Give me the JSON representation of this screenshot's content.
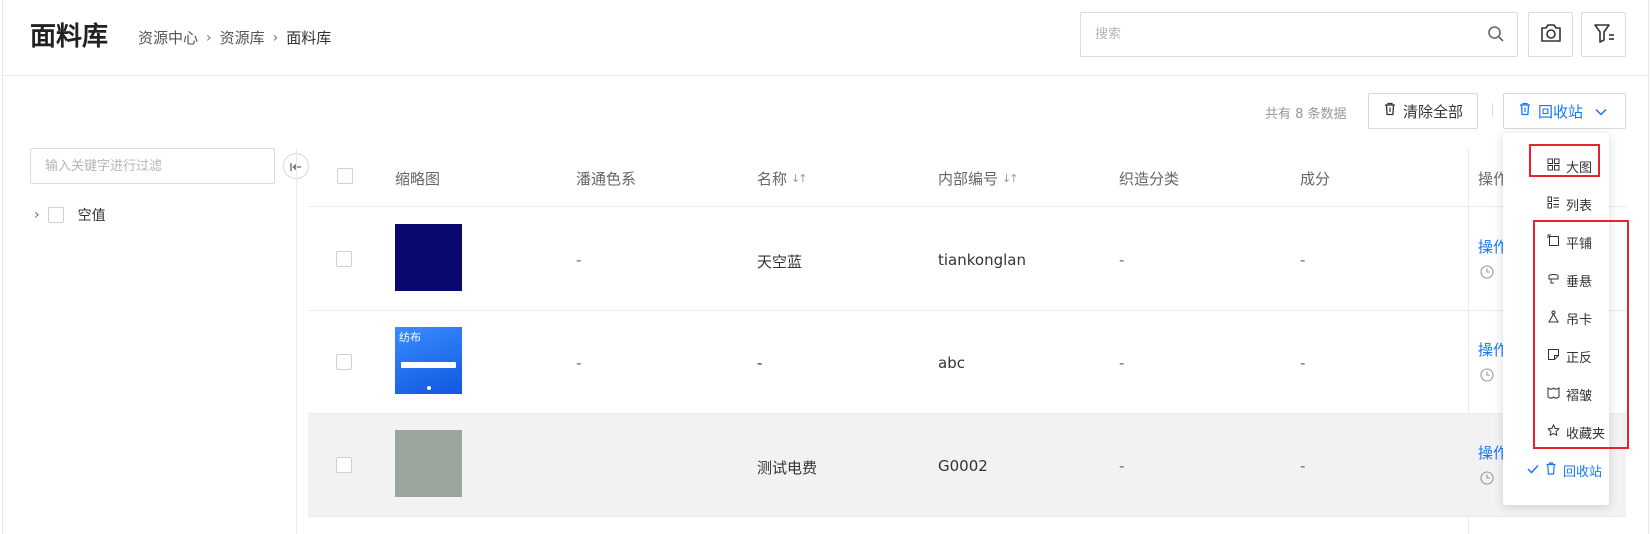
{
  "header": {
    "title": "面料库",
    "breadcrumb": [
      "资源中心",
      "资源库",
      "面料库"
    ],
    "search_placeholder": "搜索"
  },
  "toolbar": {
    "count_text": "共有 8 条数据",
    "clear_all": "清除全部",
    "recycle": "回收站"
  },
  "sidebar": {
    "filter_placeholder": "输入关键字进行过滤",
    "tree": [
      {
        "label": "空值"
      }
    ]
  },
  "table": {
    "columns": [
      "缩略图",
      "潘通色系",
      "名称",
      "内部编号",
      "织造分类",
      "成分",
      "操作"
    ],
    "rows": [
      {
        "thumb_color": "#0a0a6e",
        "pantone": "-",
        "name": "天空蓝",
        "code": "tiankonglan",
        "weave": "-",
        "composition": "-",
        "op": "操作"
      },
      {
        "thumb_color": "#1e6ff0",
        "thumb_text": "纺布",
        "pantone": "-",
        "name": "-",
        "code": "abc",
        "weave": "-",
        "composition": "-",
        "op": "操作"
      },
      {
        "thumb_color": "#9aa59c",
        "pantone": "",
        "name": "测试电费",
        "code": "G0002",
        "weave": "-",
        "composition": "-",
        "op": "操作"
      }
    ]
  },
  "menu": {
    "items": [
      {
        "label": "大图",
        "icon": "grid-icon"
      },
      {
        "label": "列表",
        "icon": "list-icon"
      },
      {
        "label": "平铺",
        "icon": "tile-icon"
      },
      {
        "label": "垂悬",
        "icon": "drape-icon"
      },
      {
        "label": "吊卡",
        "icon": "hang-tag-icon"
      },
      {
        "label": "正反",
        "icon": "flip-icon"
      },
      {
        "label": "褶皱",
        "icon": "fold-icon"
      },
      {
        "label": "收藏夹",
        "icon": "star-icon"
      },
      {
        "label": "回收站",
        "icon": "trash-icon",
        "selected": true
      }
    ]
  },
  "colors": {
    "accent": "#1677ff",
    "highlight_box": "#e8242b"
  }
}
